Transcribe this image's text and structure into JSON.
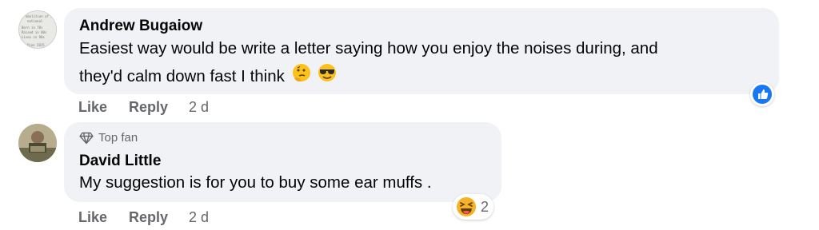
{
  "comments": [
    {
      "author": "Andrew Bugaiow",
      "text_line1": "Easiest way would be write a letter saying how you enjoy the noises during, and",
      "text_line2": "they'd calm down fast I think",
      "emojis": [
        "thinking-face",
        "smiling-face-with-sunglasses"
      ],
      "actions": {
        "like": "Like",
        "reply": "Reply",
        "time": "2 d"
      },
      "reaction": {
        "type": "like",
        "color": "#1877f2"
      }
    },
    {
      "badge": "Top fan",
      "author": "David Little",
      "text": "My suggestion is for you to buy some ear muffs .",
      "actions": {
        "like": "Like",
        "reply": "Reply",
        "time": "2 d"
      },
      "reaction": {
        "type": "haha",
        "count": "2",
        "color": "#f7b125"
      }
    }
  ],
  "colors": {
    "bubble": "#f0f2f5",
    "secondary_text": "#65676b",
    "primary_text": "#050505"
  }
}
